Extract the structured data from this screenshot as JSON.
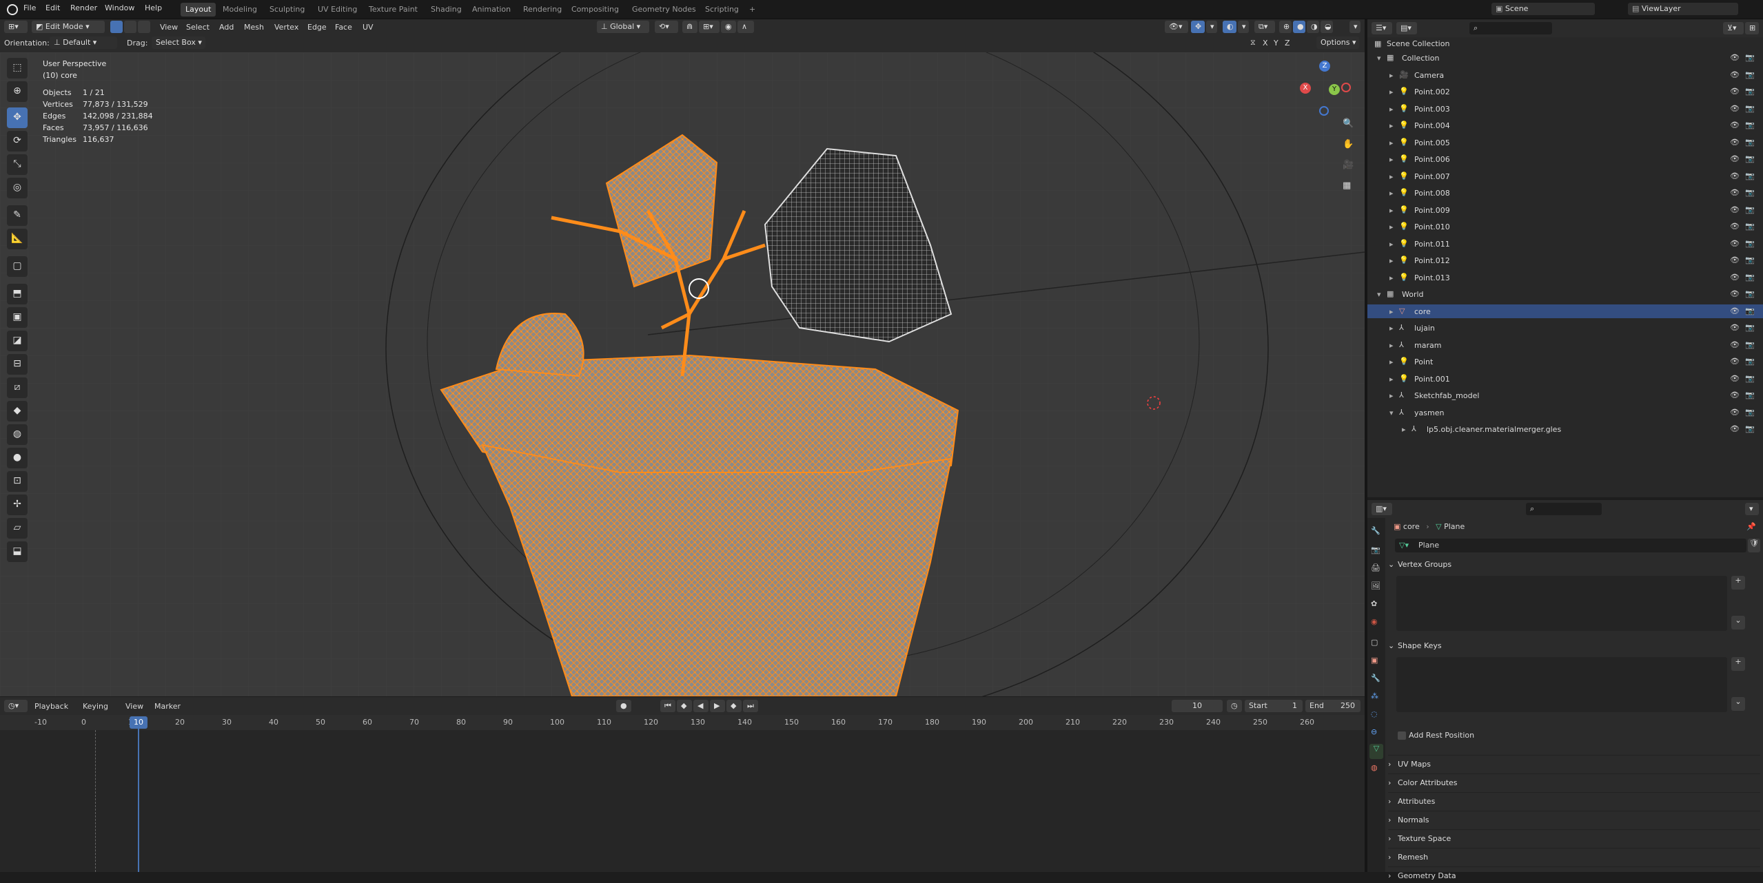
{
  "topbar": {
    "menus": [
      "File",
      "Edit",
      "Render",
      "Window",
      "Help"
    ],
    "workspaces": [
      "Layout",
      "Modeling",
      "Sculpting",
      "UV Editing",
      "Texture Paint",
      "Shading",
      "Animation",
      "Rendering",
      "Compositing",
      "Geometry Nodes",
      "Scripting"
    ],
    "active_workspace": "Layout",
    "add_tab": "+",
    "scene": "Scene",
    "view_layer": "ViewLayer"
  },
  "header": {
    "mode": "Edit Mode",
    "menus": [
      "View",
      "Select",
      "Add",
      "Mesh",
      "Vertex",
      "Edge",
      "Face",
      "UV"
    ],
    "transform_orientation": "Global",
    "orientation_label": "Orientation:",
    "orientation_value": "Default",
    "drag_label": "Drag:",
    "drag_value": "Select Box",
    "axes": [
      "X",
      "Y",
      "Z"
    ],
    "options": "Options"
  },
  "viewport": {
    "perspective": "User Perspective",
    "object": "(10) core",
    "stats": [
      {
        "label": "Objects",
        "value": "1 / 21"
      },
      {
        "label": "Vertices",
        "value": "77,873 / 131,529"
      },
      {
        "label": "Edges",
        "value": "142,098 / 231,884"
      },
      {
        "label": "Faces",
        "value": "73,957 / 116,636"
      },
      {
        "label": "Triangles",
        "value": "116,637"
      }
    ],
    "gizmo": {
      "z": "Z",
      "y": "Y",
      "x": "X"
    }
  },
  "timeline": {
    "menus": [
      "Playback",
      "Keying",
      "View",
      "Marker"
    ],
    "current_frame": "10",
    "start_label": "Start",
    "start": "1",
    "end_label": "End",
    "end": "250",
    "ticks": [
      "-10",
      "0",
      "10",
      "20",
      "30",
      "40",
      "50",
      "60",
      "70",
      "80",
      "90",
      "100",
      "110",
      "120",
      "130",
      "140",
      "150",
      "160",
      "170",
      "180",
      "190",
      "200",
      "210",
      "220",
      "230",
      "240",
      "250",
      "260"
    ]
  },
  "outliner": {
    "root": "Scene Collection",
    "rows": [
      {
        "label": "Collection",
        "indent": 1,
        "kind": "collection"
      },
      {
        "label": "Camera",
        "indent": 2,
        "kind": "camera"
      },
      {
        "label": "Point.002",
        "indent": 2,
        "kind": "light"
      },
      {
        "label": "Point.003",
        "indent": 2,
        "kind": "light"
      },
      {
        "label": "Point.004",
        "indent": 2,
        "kind": "light"
      },
      {
        "label": "Point.005",
        "indent": 2,
        "kind": "light"
      },
      {
        "label": "Point.006",
        "indent": 2,
        "kind": "light"
      },
      {
        "label": "Point.007",
        "indent": 2,
        "kind": "light"
      },
      {
        "label": "Point.008",
        "indent": 2,
        "kind": "light"
      },
      {
        "label": "Point.009",
        "indent": 2,
        "kind": "light"
      },
      {
        "label": "Point.010",
        "indent": 2,
        "kind": "light"
      },
      {
        "label": "Point.011",
        "indent": 2,
        "kind": "light"
      },
      {
        "label": "Point.012",
        "indent": 2,
        "kind": "light"
      },
      {
        "label": "Point.013",
        "indent": 2,
        "kind": "light"
      },
      {
        "label": "World",
        "indent": 1,
        "kind": "collection"
      },
      {
        "label": "core",
        "indent": 2,
        "kind": "mesh",
        "selected": true
      },
      {
        "label": "lujain",
        "indent": 2,
        "kind": "empty"
      },
      {
        "label": "maram",
        "indent": 2,
        "kind": "empty"
      },
      {
        "label": "Point",
        "indent": 2,
        "kind": "light"
      },
      {
        "label": "Point.001",
        "indent": 2,
        "kind": "light"
      },
      {
        "label": "Sketchfab_model",
        "indent": 2,
        "kind": "empty"
      },
      {
        "label": "yasmen",
        "indent": 2,
        "kind": "empty"
      },
      {
        "label": "lp5.obj.cleaner.materialmerger.gles",
        "indent": 3,
        "kind": "empty"
      }
    ]
  },
  "properties": {
    "breadcrumb_object": "core",
    "breadcrumb_sep": "›",
    "breadcrumb_data": "Plane",
    "data_name": "Plane",
    "panels": [
      "Vertex Groups",
      "Shape Keys"
    ],
    "add_rest_position": "Add Rest Position",
    "collapsed_panels": [
      "UV Maps",
      "Color Attributes",
      "Attributes",
      "Normals",
      "Texture Space",
      "Remesh",
      "Geometry Data"
    ]
  },
  "colors": {
    "accent": "#4772b3",
    "selection": "#ff8c1a",
    "selected_row": "#334d80"
  }
}
